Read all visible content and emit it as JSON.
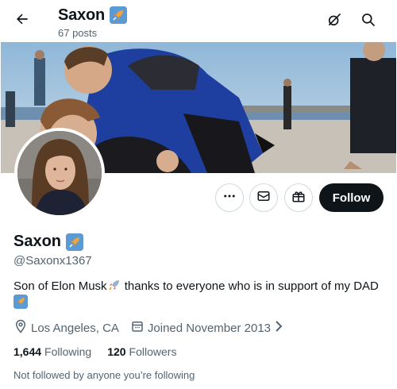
{
  "header": {
    "name": "Saxon",
    "posts_count": "67 posts"
  },
  "profile": {
    "display_name": "Saxon",
    "handle": "@Saxonx1367",
    "bio_part1": "Son of Elon Musk",
    "bio_part2": " thanks to everyone who is in support of my DAD",
    "location": "Los Angeles, CA",
    "joined": "Joined November 2013",
    "following_count": "1,644",
    "following_label": "Following",
    "followers_count": "120",
    "followers_label": "Followers",
    "not_followed_text": "Not followed by anyone you’re following"
  },
  "actions": {
    "follow_label": "Follow"
  },
  "icons": {
    "back": "arrow-left-icon",
    "grok": "grok-icon",
    "search": "search-icon",
    "more": "more-icon",
    "message": "envelope-icon",
    "subscribe": "gift-icon",
    "location": "location-pin-icon",
    "calendar": "calendar-icon",
    "badge": "rocket-badge-icon",
    "rocket_emoji": "rocket-emoji-icon"
  },
  "colors": {
    "follow_button": "#0f1419",
    "secondary_text": "#536471",
    "badge": "#6fa9d8"
  }
}
